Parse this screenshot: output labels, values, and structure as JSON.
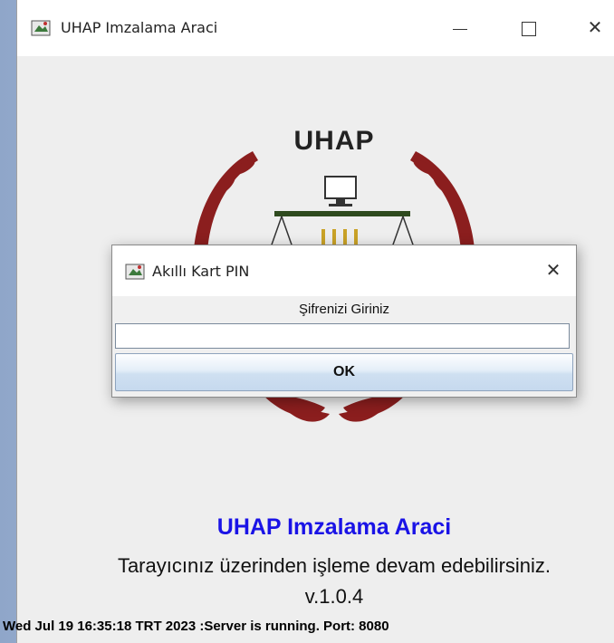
{
  "window": {
    "title": "UHAP Imzalama Araci",
    "controls": {
      "minimize": "minimize-icon",
      "maximize": "maximize-icon",
      "close": "close-icon"
    }
  },
  "logo": {
    "text": "UHAP"
  },
  "main": {
    "app_name": "UHAP Imzalama Araci",
    "subtitle": "Tarayıcınız üzerinden işleme devam edebilirsiniz.",
    "version": "v.1.0.4",
    "status": "Wed Jul 19 16:35:18 TRT 2023 :Server is running. Port: 8080"
  },
  "dialog": {
    "title": "Akıllı Kart PIN",
    "prompt": "Şifrenizi Giriniz",
    "input_value": "",
    "ok_label": "OK"
  },
  "colors": {
    "app_name": "#1a13e6",
    "laurel": "#8b1e1e",
    "scale_bar": "#2e4a1e"
  }
}
